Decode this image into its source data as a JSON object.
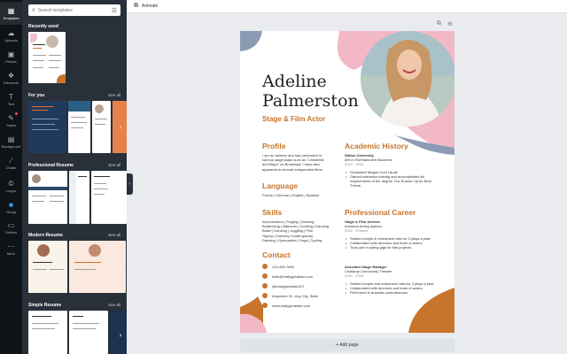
{
  "rail": [
    {
      "label": "Templates",
      "icon": "templates-icon",
      "glyph": "▦",
      "active": true
    },
    {
      "label": "Uploads",
      "icon": "upload-icon",
      "glyph": "☁"
    },
    {
      "label": "Photos",
      "icon": "photos-icon",
      "glyph": "▣"
    },
    {
      "label": "Elements",
      "icon": "elements-icon",
      "glyph": "❖"
    },
    {
      "label": "Text",
      "icon": "text-icon",
      "glyph": "T"
    },
    {
      "label": "Styles",
      "icon": "styles-icon",
      "glyph": "✎",
      "dot": true
    },
    {
      "label": "Background",
      "icon": "background-icon",
      "glyph": "▤"
    },
    {
      "label": "Charts",
      "icon": "charts-icon",
      "glyph": "📈"
    },
    {
      "label": "Logos",
      "icon": "logos-icon",
      "glyph": "©"
    },
    {
      "label": "Group",
      "icon": "group-icon",
      "glyph": "■"
    },
    {
      "label": "Folders",
      "icon": "folders-icon",
      "glyph": "▭"
    },
    {
      "label": "More",
      "icon": "more-icon",
      "glyph": "⋯"
    }
  ],
  "panel": {
    "search_placeholder": "Search templates",
    "sections": {
      "recent": "Recently used",
      "for_you": "For you",
      "professional": "Professional Resume",
      "modern": "Modern Resume",
      "simple": "Simple Resume"
    },
    "see_all": "See all"
  },
  "topbar": {
    "animate_label": "Animate"
  },
  "resume": {
    "first_name": "Adeline",
    "last_name": "Palmerston",
    "role": "Stage & Film Actor",
    "profile_heading": "Profile",
    "profile_text": "I am an actress who has performed in various stage plays such as \"Lindsbelle and Maps\" on Broadway. I have also appeared in several independent films.",
    "language_heading": "Language",
    "language_text": "French | German | English | Spanish",
    "skills_heading": "Skills",
    "skills_lines": [
      "Improvisation | Singing | Dancing",
      "Beatboxing | Ballroom | Cooking | Dancing",
      "Ballet | Dancing | Juggling | Pole",
      "Hiphop | Dancing Contemporary",
      "Dancing | Gymnastics | Yoga | Cycling"
    ],
    "contact_heading": "Contact",
    "contacts": [
      "123-456-7890",
      "hello@reallygreatsite.com",
      "@reallygreatsite123",
      "Anywhere St., Any City, State",
      "www.reallygreatsite.com"
    ],
    "academic_heading": "Academic History",
    "academic": {
      "school": "Stilton University",
      "degree": "MS in Entertainment Business",
      "years": "2010 - 2016",
      "bullets": [
        "Graduated Magna Cum Laude",
        "Gained extensive training and accomplished all requirements of the degree. Dot Runner Up for Best Thesis."
      ]
    },
    "career_heading": "Professional Career",
    "jobs": [
      {
        "title": "Stage & Film Actress",
        "company": "Astraeus Acting Agency",
        "years": "2016 - Present",
        "bullets": [
          "Studied scripts & rehearsed roles for 2 plays a year",
          "Collaborated with directors and team of actors",
          "Took part in acting gigs for film projects"
        ]
      },
      {
        "title": "Assistant Stage Manager",
        "company": "Challamp Community Theater",
        "years": "2010 - 2016",
        "bullets": [
          "Studied scripts and rehearsed roles for 2 plays a year",
          "Collaborated with directors and team of actors",
          "Performed in dramatic performances"
        ]
      }
    ]
  },
  "add_page_label": "+ Add page",
  "colors": {
    "accent": "#c8742b",
    "pink": "#f2b8c6",
    "slate": "#8b9bb3",
    "rail_bg": "#0e1318",
    "panel_bg": "#293039"
  }
}
